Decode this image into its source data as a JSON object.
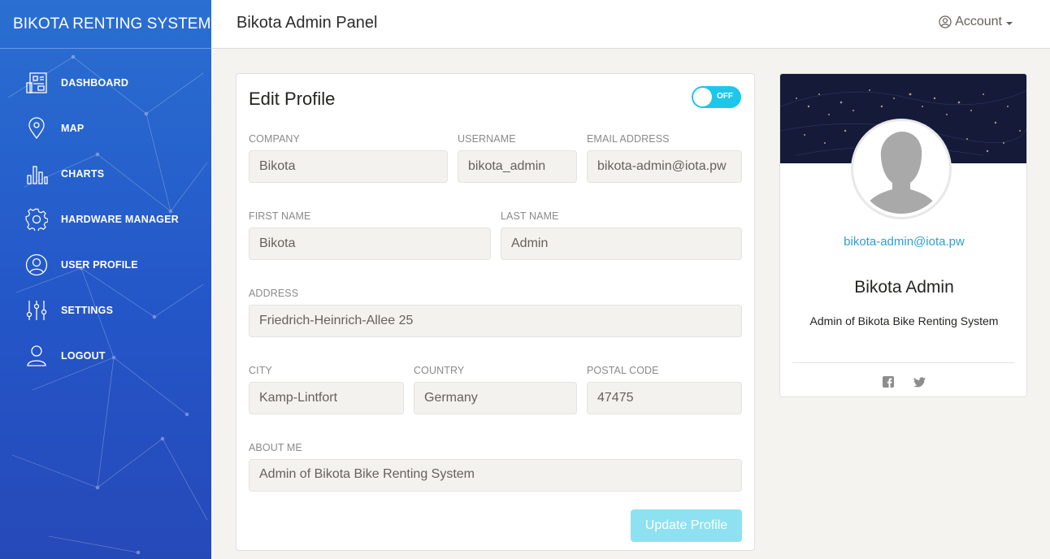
{
  "app": {
    "brand": "BIKOTA RENTING SYSTEM",
    "panel_title": "Bikota Admin Panel",
    "account_label": "Account",
    "accent_color": "#1dc7ea",
    "sidebar_color": "#2456c8"
  },
  "sidebar": {
    "items": [
      {
        "label": "DASHBOARD",
        "icon": "dashboard-icon"
      },
      {
        "label": "MAP",
        "icon": "map-pin-icon"
      },
      {
        "label": "CHARTS",
        "icon": "bar-chart-icon"
      },
      {
        "label": "HARDWARE MANAGER",
        "icon": "gear-icon"
      },
      {
        "label": "USER PROFILE",
        "icon": "user-circle-icon"
      },
      {
        "label": "SETTINGS",
        "icon": "sliders-icon"
      },
      {
        "label": "LOGOUT",
        "icon": "user-icon"
      }
    ]
  },
  "edit": {
    "title": "Edit Profile",
    "toggle_label": "OFF",
    "fields": {
      "company": {
        "label": "COMPANY",
        "value": "Bikota"
      },
      "username": {
        "label": "USERNAME",
        "value": "bikota_admin"
      },
      "email": {
        "label": "EMAIL ADDRESS",
        "value": "bikota-admin@iota.pw"
      },
      "first_name": {
        "label": "FIRST NAME",
        "value": "Bikota"
      },
      "last_name": {
        "label": "LAST NAME",
        "value": "Admin"
      },
      "address": {
        "label": "ADDRESS",
        "value": "Friedrich-Heinrich-Allee 25"
      },
      "city": {
        "label": "CITY",
        "value": "Kamp-Lintfort"
      },
      "country": {
        "label": "COUNTRY",
        "value": "Germany"
      },
      "postal_code": {
        "label": "POSTAL CODE",
        "value": "47475"
      },
      "about": {
        "label": "ABOUT ME",
        "value": "Admin of Bikota Bike Renting System"
      }
    },
    "submit_label": "Update Profile"
  },
  "profile": {
    "email": "bikota-admin@iota.pw",
    "name": "Bikota Admin",
    "description": "Admin of Bikota Bike Renting System",
    "social": [
      "facebook-icon",
      "twitter-icon"
    ]
  }
}
